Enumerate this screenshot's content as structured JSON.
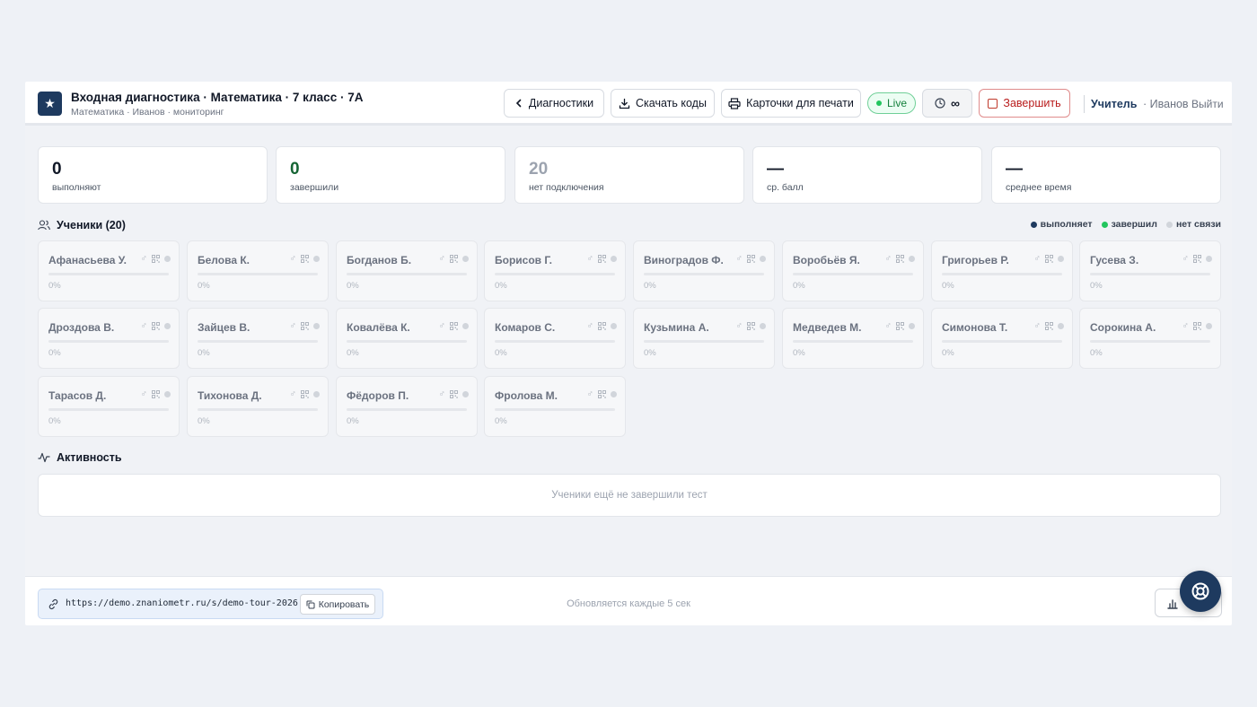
{
  "header": {
    "logo_glyph": "★",
    "title": "Входная диагностика · Математика · 7 класс · 7А",
    "subtitle": "Математика · Иванов · мониторинг",
    "diag_label": "Диагностики",
    "codes_label": "Скачать коды",
    "cards_label": "Карточки для печати",
    "live_label": "Live",
    "timer_value": "∞",
    "finish_label": "Завершить",
    "user_role": "Учитель",
    "user_name": "· Иванов",
    "logout_label": "Выйти"
  },
  "stats": [
    {
      "value": "0",
      "label": "выполняют"
    },
    {
      "value": "0",
      "label": "завершили"
    },
    {
      "value": "20",
      "label": "нет подключения"
    },
    {
      "value": "—",
      "label": "ср. балл"
    },
    {
      "value": "—",
      "label": "среднее время"
    }
  ],
  "students_section": {
    "title": "Ученики (20)",
    "legend": [
      "выполняет",
      "завершил",
      "нет связи"
    ]
  },
  "students": [
    {
      "name": "Афанасьева У.",
      "progress": "0%"
    },
    {
      "name": "Белова К.",
      "progress": "0%"
    },
    {
      "name": "Богданов Б.",
      "progress": "0%"
    },
    {
      "name": "Борисов Г.",
      "progress": "0%"
    },
    {
      "name": "Виноградов Ф.",
      "progress": "0%"
    },
    {
      "name": "Воробьёв Я.",
      "progress": "0%"
    },
    {
      "name": "Григорьев Р.",
      "progress": "0%"
    },
    {
      "name": "Гусева З.",
      "progress": "0%"
    },
    {
      "name": "Дроздова В.",
      "progress": "0%"
    },
    {
      "name": "Зайцев В.",
      "progress": "0%"
    },
    {
      "name": "Ковалёва К.",
      "progress": "0%"
    },
    {
      "name": "Комаров С.",
      "progress": "0%"
    },
    {
      "name": "Кузьмина А.",
      "progress": "0%"
    },
    {
      "name": "Медведев М.",
      "progress": "0%"
    },
    {
      "name": "Симонова Т.",
      "progress": "0%"
    },
    {
      "name": "Сорокина А.",
      "progress": "0%"
    },
    {
      "name": "Тарасов Д.",
      "progress": "0%"
    },
    {
      "name": "Тихонова Д.",
      "progress": "0%"
    },
    {
      "name": "Фёдоров П.",
      "progress": "0%"
    },
    {
      "name": "Фролова М.",
      "progress": "0%"
    }
  ],
  "activity": {
    "title": "Активность",
    "empty_text": "Ученики ещё не завершили тест"
  },
  "footer": {
    "url": "https://demo.znaniometr.ru/s/demo-tour-2026",
    "copy_label": "Копировать",
    "refresh_text": "Обновляется каждые 5 сек"
  },
  "colors": {
    "brand": "#1e3a5f",
    "status_working": "#1e3a5f",
    "status_done": "#22c55e",
    "status_offline": "#d1d5db"
  }
}
